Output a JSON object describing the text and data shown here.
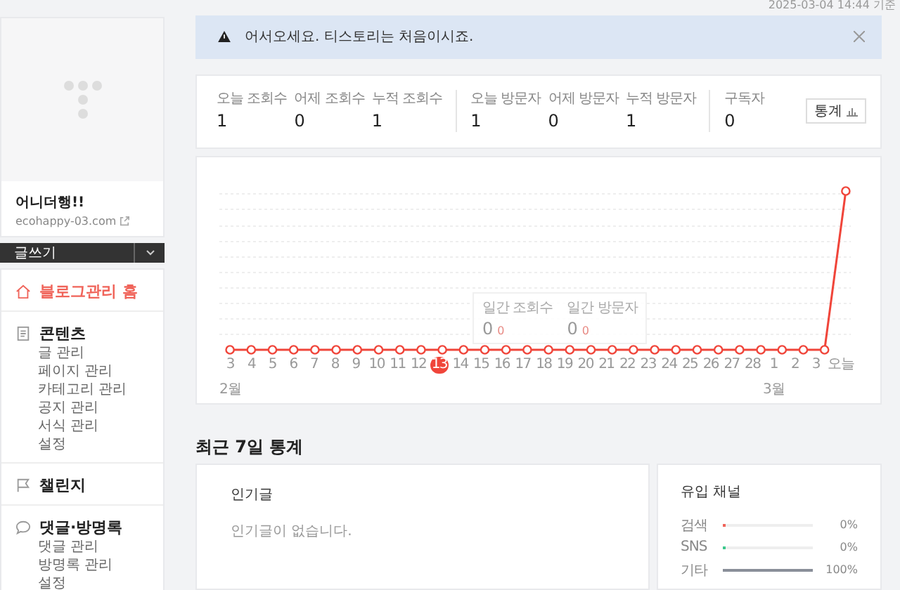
{
  "timestamp": "2025-03-04 14:44 기준",
  "profile": {
    "kind": "picture",
    "name": "어니더행!!",
    "url": "ecohappy-03.com"
  },
  "write_button": {
    "label": "글쓰기"
  },
  "menu": [
    {
      "kind": "home",
      "label": "블로그관리 홈",
      "selected": true
    },
    {
      "kind": "doc",
      "label": "콘텐츠",
      "selected": false,
      "children": [
        {
          "label": "글 관리"
        },
        {
          "label": "페이지 관리"
        },
        {
          "label": "카테고리 관리"
        },
        {
          "label": "공지 관리"
        },
        {
          "label": "서식 관리"
        },
        {
          "label": "설정"
        }
      ]
    },
    {
      "kind": "flag",
      "label": "챌린지",
      "selected": false
    },
    {
      "kind": "chat",
      "label": "댓글·방명록",
      "selected": false,
      "children": [
        {
          "label": "댓글 관리"
        },
        {
          "label": "방명록 관리"
        },
        {
          "label": "설정"
        }
      ]
    }
  ],
  "banner": {
    "message": "어서오세요. 티스토리는 처음이시죠."
  },
  "stats": {
    "groups": [
      [
        {
          "label": "오늘 조회수",
          "value": "1"
        },
        {
          "label": "어제 조회수",
          "value": "0"
        },
        {
          "label": "누적 조회수",
          "value": "1"
        }
      ],
      [
        {
          "label": "오늘 방문자",
          "value": "1"
        },
        {
          "label": "어제 방문자",
          "value": "0"
        },
        {
          "label": "누적 방문자",
          "value": "1"
        }
      ],
      [
        {
          "label": "구독자",
          "value": "0"
        }
      ]
    ],
    "button": "통계"
  },
  "chart": {
    "x_labels": [
      {
        "label": "3",
        "month": "2월",
        "selected": false
      },
      {
        "label": "4",
        "selected": false
      },
      {
        "label": "5",
        "selected": false
      },
      {
        "label": "6",
        "selected": false
      },
      {
        "label": "7",
        "selected": false
      },
      {
        "label": "8",
        "selected": false
      },
      {
        "label": "9",
        "selected": false
      },
      {
        "label": "10",
        "selected": false
      },
      {
        "label": "11",
        "selected": false
      },
      {
        "label": "12",
        "selected": false
      },
      {
        "label": "13",
        "selected": true
      },
      {
        "label": "14",
        "selected": false
      },
      {
        "label": "15",
        "selected": false
      },
      {
        "label": "16",
        "selected": false
      },
      {
        "label": "17",
        "selected": false
      },
      {
        "label": "18",
        "selected": false
      },
      {
        "label": "19",
        "selected": false
      },
      {
        "label": "20",
        "selected": false
      },
      {
        "label": "21",
        "selected": false
      },
      {
        "label": "22",
        "selected": false
      },
      {
        "label": "23",
        "selected": false
      },
      {
        "label": "24",
        "selected": false
      },
      {
        "label": "25",
        "selected": false
      },
      {
        "label": "26",
        "selected": false
      },
      {
        "label": "27",
        "selected": false
      },
      {
        "label": "28",
        "selected": false
      },
      {
        "label": "1",
        "month": "3월",
        "selected": false
      },
      {
        "label": "2",
        "selected": false
      },
      {
        "label": "3",
        "selected": false
      },
      {
        "label": "오늘",
        "selected": false
      }
    ],
    "tooltip": [
      {
        "label": "일간 조회수",
        "value": "0",
        "change": "0"
      },
      {
        "label": "일간 방문자",
        "value": "0",
        "change": "0"
      }
    ]
  },
  "section_title": "최근 7일 통계",
  "popular": {
    "title": "인기글",
    "empty": "인기글이 없습니다."
  },
  "inflow": {
    "title": "유입 채널",
    "channels": [
      {
        "name": "검색",
        "level": 0,
        "color": "#f0645a",
        "reading": "0%"
      },
      {
        "name": "SNS",
        "level": 0,
        "color": "#3cc88c",
        "reading": "0%"
      },
      {
        "name": "기타",
        "level": 1,
        "color": "#8a8f99",
        "reading": "100%"
      }
    ]
  }
}
